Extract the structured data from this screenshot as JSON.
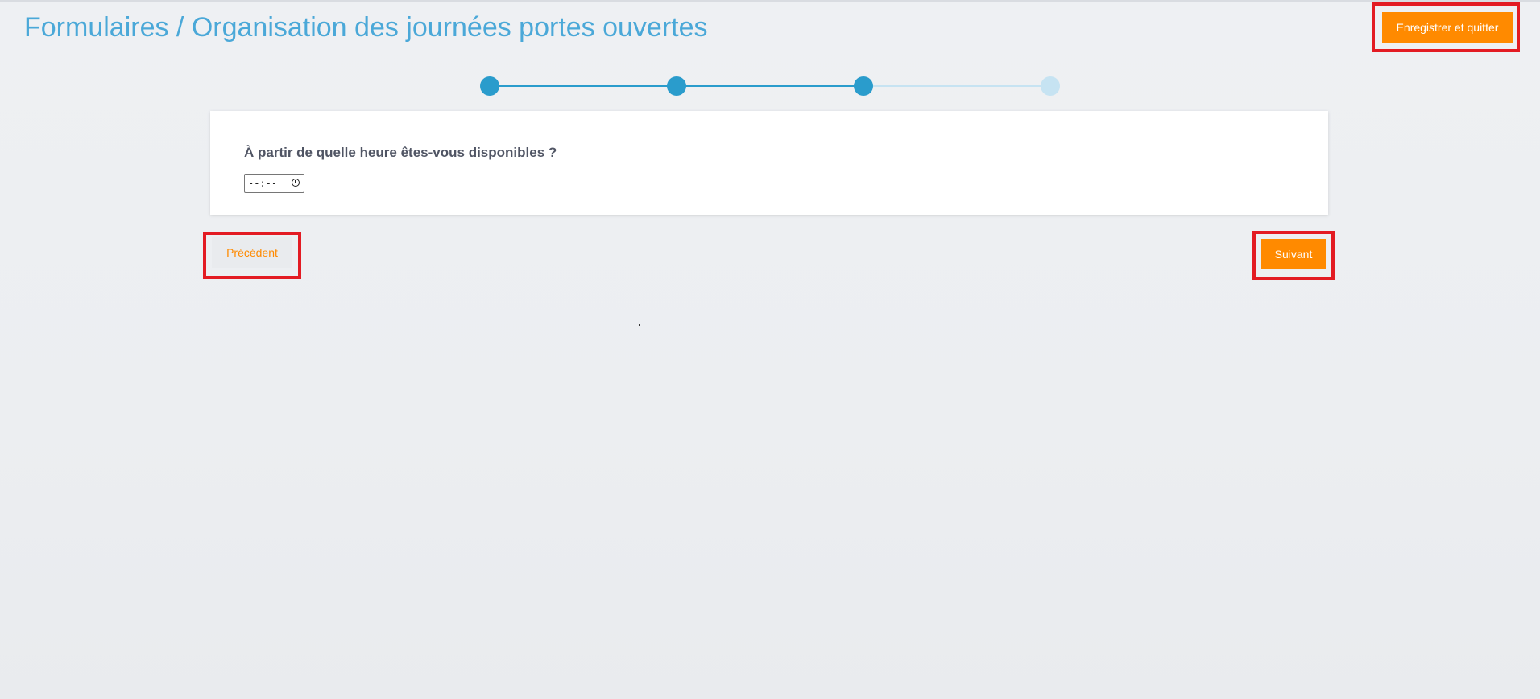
{
  "header": {
    "title": "Formulaires / Organisation des journées portes ouvertes",
    "save_quit_label": "Enregistrer et quitter"
  },
  "stepper": {
    "total_steps": 4,
    "current_step": 3,
    "active_color": "#2a9ccc",
    "inactive_color": "#c6e3f2"
  },
  "form": {
    "question": "À partir de quelle heure êtes-vous disponibles ?",
    "time_value": "--:--"
  },
  "navigation": {
    "previous_label": "Précédent",
    "next_label": "Suivant"
  },
  "colors": {
    "accent": "#ff8a00",
    "title": "#4aa8d8",
    "highlight": "#e31b23"
  }
}
